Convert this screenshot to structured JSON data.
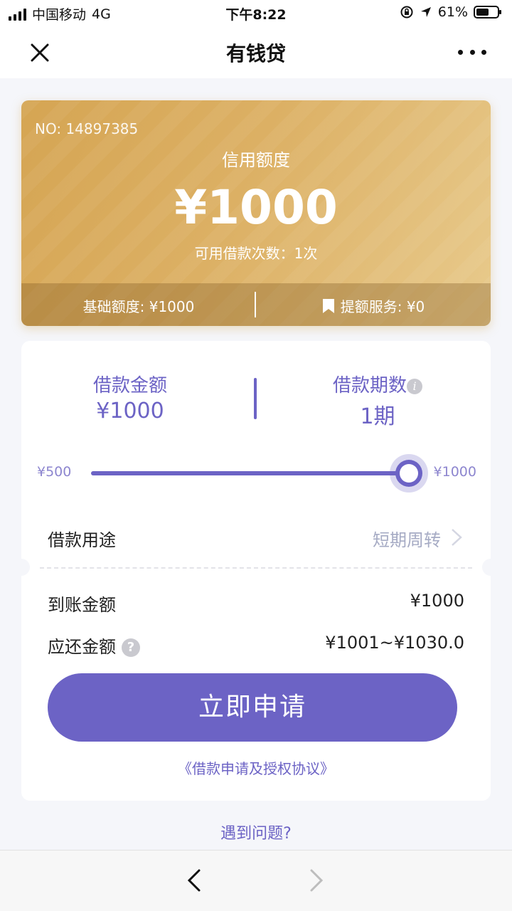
{
  "status_bar": {
    "carrier": "中国移动",
    "network": "4G",
    "time": "下午8:22",
    "battery_percent": "61%",
    "battery_level": 0.61
  },
  "nav": {
    "title": "有钱贷",
    "icons": {
      "close": "close-icon",
      "more": "more-icon"
    }
  },
  "card": {
    "no": "NO: 14897385",
    "label": "信用额度",
    "amount": "¥1000",
    "count": "可用借款次数：1次",
    "base_quota": "基础额度: ¥1000",
    "boost_service": "提额服务: ¥0",
    "boost_icon": "bookmark-icon"
  },
  "loan": {
    "amount_title": "借款金额",
    "amount_value": "¥1000",
    "term_title": "借款期数",
    "term_value": "1期",
    "term_info_glyph": "i",
    "slider_min": "¥500",
    "slider_max": "¥1000",
    "slider_value": 1.0,
    "purpose_label": "借款用途",
    "purpose_value": "短期周转",
    "arrival_label": "到账金额",
    "arrival_value": "¥1000",
    "repay_label": "应还金额",
    "repay_help_glyph": "?",
    "repay_value": "¥1001~¥1030.0",
    "apply_button": "立即申请",
    "agreement": "《借款申请及授权协议》"
  },
  "help": {
    "link": "遇到问题?"
  },
  "colors": {
    "accent": "#6c63c5",
    "card_gold": "#dcb064",
    "muted": "#a6abc4"
  }
}
